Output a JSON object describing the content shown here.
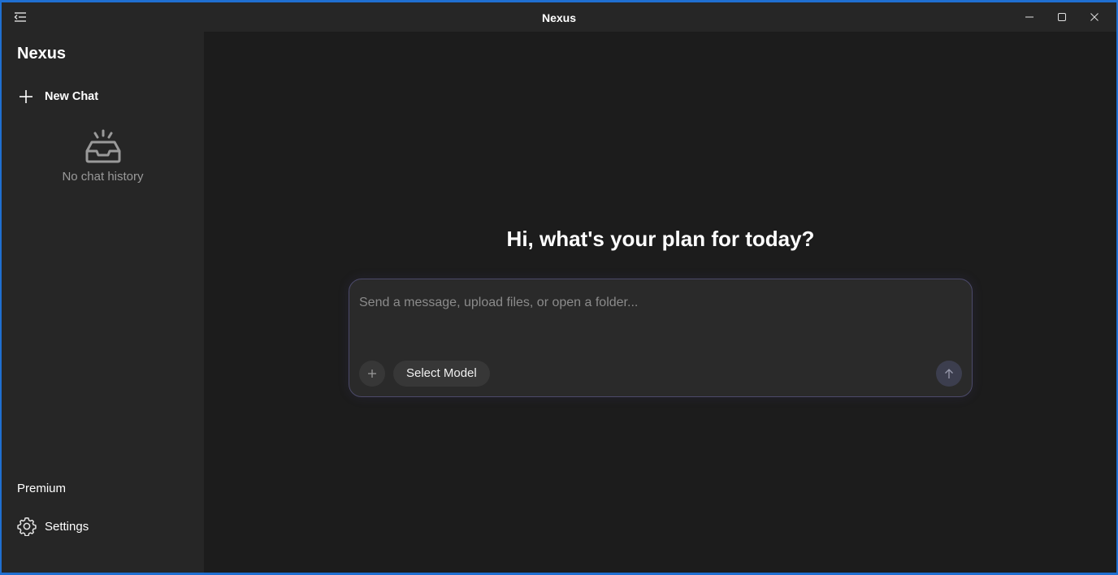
{
  "window": {
    "title": "Nexus"
  },
  "sidebar": {
    "brand": "Nexus",
    "new_chat_label": "New Chat",
    "empty_history_label": "No chat history",
    "premium_label": "Premium",
    "settings_label": "Settings"
  },
  "main": {
    "greeting": "Hi, what's your plan for today?",
    "composer": {
      "placeholder": "Send a message, upload files, or open a folder...",
      "value": "",
      "select_model_label": "Select Model"
    }
  },
  "icons": {
    "titlebar_menu": "sidebar-toggle-icon",
    "minimize": "minimize-icon",
    "maximize": "maximize-icon",
    "close": "close-icon",
    "new_chat": "plus-icon",
    "empty_history": "inbox-icon",
    "settings": "gear-icon",
    "attach": "plus-icon",
    "send": "arrow-up-icon"
  },
  "colors": {
    "background": "#1c1c1c",
    "sidebar": "#262626",
    "composer_border": "#4c4a6a",
    "send_button": "#3c3e4e",
    "desktop_accent": "#1f6fd1"
  }
}
